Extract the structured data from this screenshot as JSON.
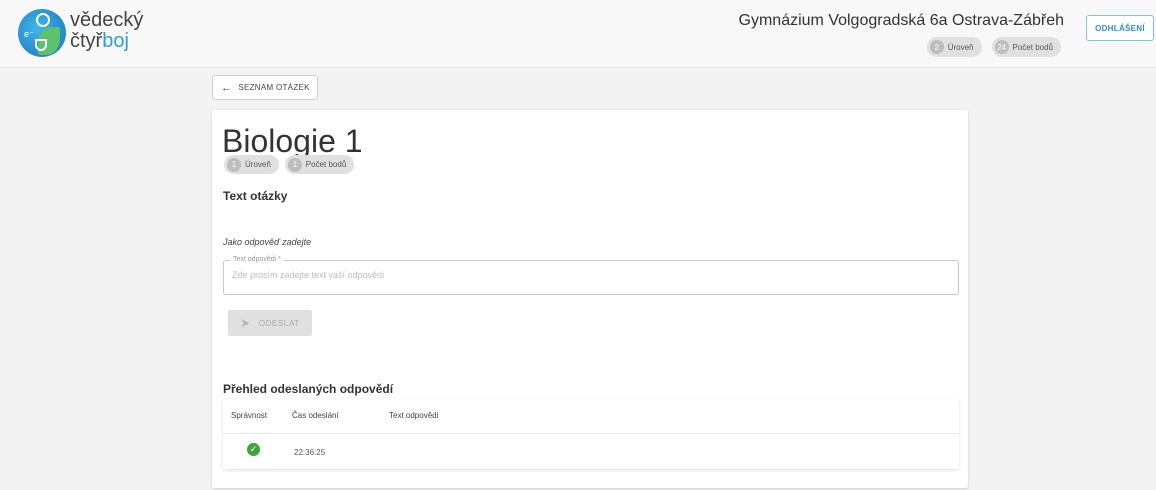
{
  "header": {
    "brand_line1": "vědecký",
    "brand_line2_a": "čtyř",
    "brand_line2_b": "boj",
    "school": "Gymnázium Volgogradská 6a Ostrava-Zábřeh",
    "chips": [
      {
        "num": "2",
        "label": "Úroveň"
      },
      {
        "num": "24",
        "label": "Počet bodů"
      }
    ],
    "logout_label": "ODHLÁŠENÍ"
  },
  "back_label": "SEZNAM OTÁZEK",
  "question": {
    "title": "Biologie 1",
    "chips": [
      {
        "num": "1",
        "label": "Úroveň"
      },
      {
        "num": "1",
        "label": "Počet bodů"
      }
    ],
    "text_heading": "Text otázky",
    "hint": "Jako odpověď zadejte",
    "answer_label": "Text odpovědi *",
    "answer_placeholder": "Zde prosím zadejte text vaší odpovědi",
    "answer_value": "",
    "send_label": "ODESLAT"
  },
  "history": {
    "title": "Přehled odeslaných odpovědí",
    "columns": [
      "Správnost",
      "Čas odeslání",
      "Text odpovědi"
    ],
    "rows": [
      {
        "correct": true,
        "time": "22:36:25",
        "text": ""
      }
    ]
  },
  "colors": {
    "accent": "#2a8fd0",
    "success": "#3da63a"
  }
}
